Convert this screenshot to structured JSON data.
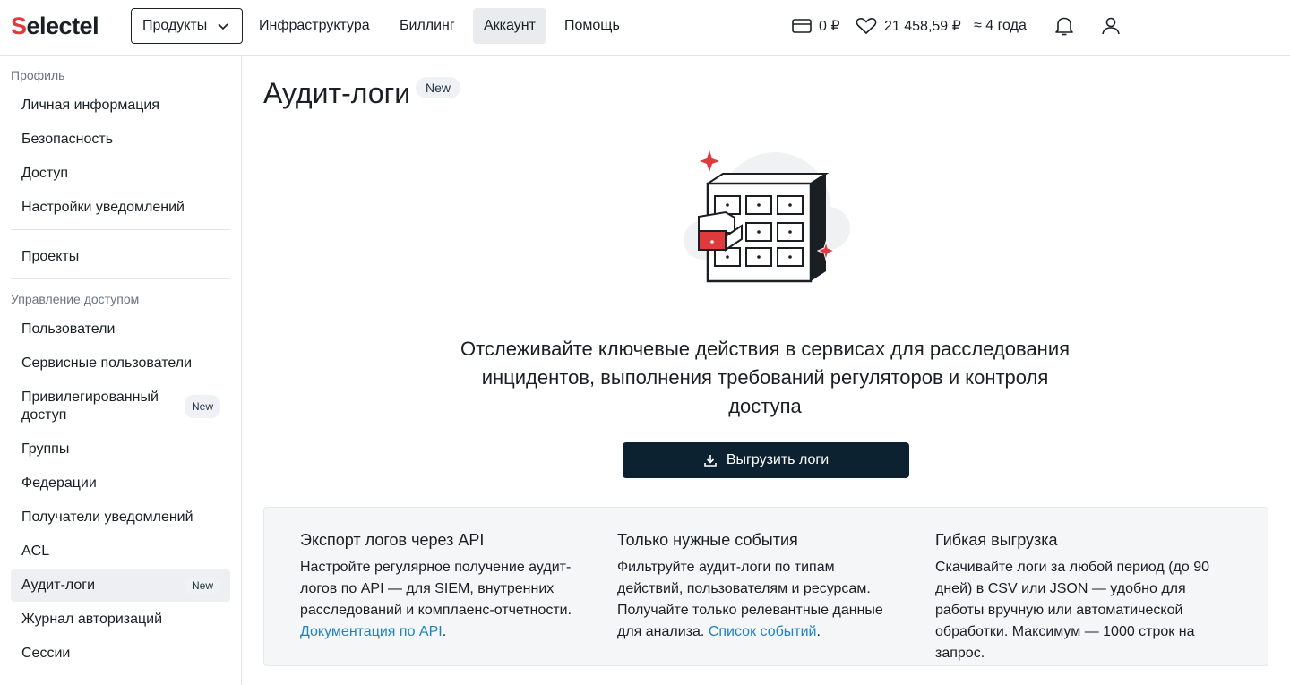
{
  "header": {
    "logo_part1": "S",
    "logo_part2": "electel",
    "products_label": "Продукты",
    "nav": [
      "Инфраструктура",
      "Биллинг",
      "Аккаунт",
      "Помощь"
    ],
    "active_nav": "Аккаунт",
    "balance": "0 ₽",
    "bonus_balance": "21 458,59 ₽",
    "forecast": "≈ 4 года",
    "icons": [
      "wallet-icon",
      "heart-icon",
      "bell-icon",
      "user-icon"
    ]
  },
  "sidebar": {
    "section_profile": "Профиль",
    "profile_items": [
      "Личная информация",
      "Безопасность",
      "Доступ",
      "Настройки уведомлений"
    ],
    "projects": "Проекты",
    "section_access": "Управление доступом",
    "access_items": [
      {
        "label": "Пользователи",
        "badge": ""
      },
      {
        "label": "Сервисные пользователи",
        "badge": ""
      },
      {
        "label": "Привилегированный доступ",
        "badge": "New"
      },
      {
        "label": "Группы",
        "badge": ""
      },
      {
        "label": "Федерации",
        "badge": ""
      },
      {
        "label": "Получатели уведомлений",
        "badge": ""
      },
      {
        "label": "ACL",
        "badge": ""
      },
      {
        "label": "Аудит-логи",
        "badge": "New"
      },
      {
        "label": "Журнал авторизаций",
        "badge": ""
      },
      {
        "label": "Сессии",
        "badge": ""
      }
    ],
    "active_item": "Аудит-логи"
  },
  "main": {
    "title": "Аудит-логи",
    "title_badge": "New",
    "description": "Отслеживайте ключевые действия в сервисах для расследования инцидентов, выполнения требований регуляторов и контроля доступа",
    "export_button": "Выгрузить логи",
    "features": [
      {
        "title": "Экспорт логов через API",
        "text": "Настройте регулярное получение аудит-логов по API — для SIEM, внутренних расследований и комплаенс-отчетности.",
        "link": "Документация по API",
        "link_suffix": "."
      },
      {
        "title": "Только нужные события",
        "text": "Фильтруйте аудит-логи по типам действий, пользователям и ресурсам. Получайте только релевантные данные для анализа.",
        "link": "Список событий",
        "link_suffix": "."
      },
      {
        "title": "Гибкая выгрузка",
        "text": "Скачивайте логи за любой период (до 90 дней) в CSV или JSON — удобно для работы вручную или автоматической обработки. Максимум — 1000 строк на запрос.",
        "link": "",
        "link_suffix": ""
      }
    ]
  },
  "colors": {
    "accent_red": "#e0393e",
    "button_dark": "#0d2231",
    "link_blue": "#1f82c4",
    "active_bg": "#edeff2"
  }
}
